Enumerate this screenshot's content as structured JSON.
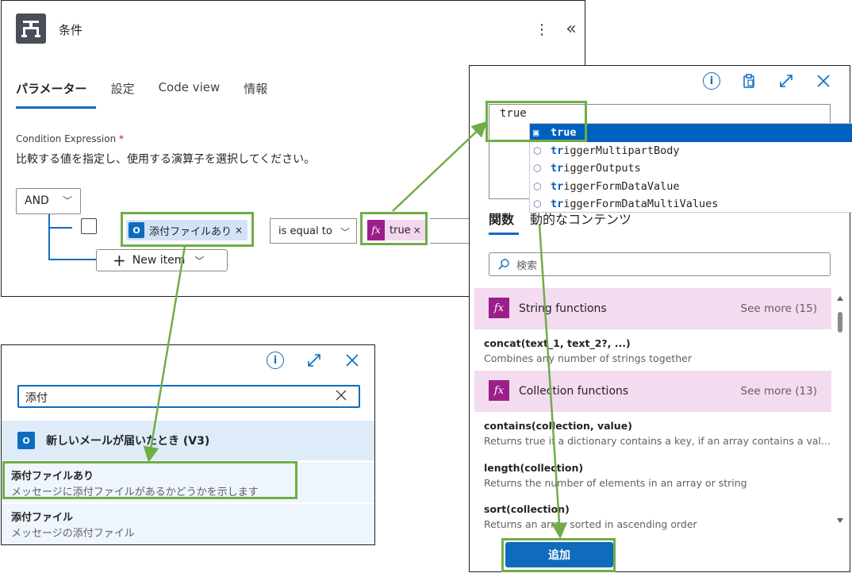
{
  "panel_condition": {
    "title": "条件",
    "tabs": [
      "パラメーター",
      "設定",
      "Code view",
      "情報"
    ],
    "condition_label": "Condition Expression",
    "required_mark": "*",
    "description": "比較する値を指定し、使用する演算子を選択してください。",
    "logic_operator": "AND",
    "left_token": "添付ファイルあり",
    "token_remove": "×",
    "operator": "is equal to",
    "right_token": "true",
    "new_item_label": "New item",
    "more_icon": "⋮",
    "collapse_icon": "«"
  },
  "panel_dynamic": {
    "search_value": "添付",
    "group_title": "新しいメールが届いたとき (V3)",
    "items": [
      {
        "title": "添付ファイルあり",
        "subtitle": "メッセージに添付ファイルがあるかどうかを示します"
      },
      {
        "title": "添付ファイル",
        "subtitle": "メッセージの添付ファイル"
      }
    ]
  },
  "panel_expression": {
    "expression_value": "true",
    "suggestions": [
      {
        "match": "true",
        "rest": "",
        "selected": true
      },
      {
        "match": "tr",
        "rest": "iggerMultipartBody",
        "selected": false
      },
      {
        "match": "tr",
        "rest": "iggerOutputs",
        "selected": false
      },
      {
        "match": "tr",
        "rest": "iggerFormDataValue",
        "selected": false
      },
      {
        "match": "tr",
        "rest": "iggerFormDataMultiValues",
        "selected": false
      }
    ],
    "tabs": [
      "関数",
      "動的なコンテンツ"
    ],
    "search_placeholder": "検索",
    "categories": [
      {
        "name": "String functions",
        "more": "See more (15)"
      },
      {
        "name": "Collection functions",
        "more": "See more (13)"
      }
    ],
    "functions": [
      {
        "name": "concat(text_1, text_2?, ...)",
        "desc": "Combines any number of strings together"
      },
      {
        "name": "contains(collection, value)",
        "desc": "Returns true if a dictionary contains a key, if an array contains a val..."
      },
      {
        "name": "length(collection)",
        "desc": "Returns the number of elements in an array or string"
      },
      {
        "name": "sort(collection)",
        "desc": "Returns an array sorted in ascending order"
      }
    ],
    "add_button": "追加"
  },
  "colors": {
    "accent": "#0f6cbd",
    "highlight": "#70ad47",
    "fx": "#9c1f89"
  }
}
